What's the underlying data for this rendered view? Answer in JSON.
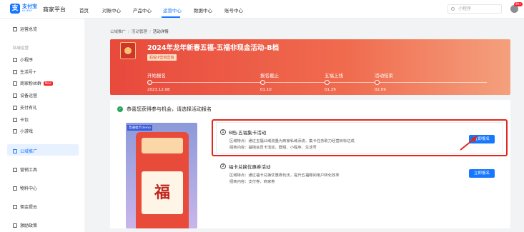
{
  "header": {
    "logo_cn": "支付宝",
    "logo_en": "ALIPAY",
    "platform": "商家平台",
    "nav": [
      "首页",
      "对账中心",
      "产品中心",
      "运营中心",
      "数据中心",
      "账号中心"
    ],
    "active_nav": "运营中心",
    "search_placeholder": "小程序",
    "avatar_badge": "99+"
  },
  "sidebar": {
    "top_item": "运营总览",
    "group_label": "私域运营",
    "items": [
      "小程序",
      "生活号+",
      "商家粉丝群",
      "设备运营",
      "支付有礼",
      "卡包",
      "小游戏"
    ],
    "new_badge": "New",
    "active_item": "公域推广",
    "bottom_items": [
      "营销工具",
      "物料中心",
      "佣金提云",
      "激励政策"
    ]
  },
  "breadcrumb": [
    "公域推广",
    "活动管理",
    "活动详情"
  ],
  "banner": {
    "title": "2024年龙年新春五福-五福非现金活动-B档",
    "tag": "蚂蚁IP营销营销",
    "timeline": [
      {
        "label": "开始报名",
        "date": "2023.12.08"
      },
      {
        "label": "报名截止",
        "date": "01.10"
      },
      {
        "label": "五福上线",
        "date": "01.29"
      },
      {
        "label": "活动结束",
        "date": "02.09"
      }
    ]
  },
  "content": {
    "congrats": "恭喜您获得参与机会，请选择活动报名",
    "promo_label": "普通福卡demo",
    "promo_char": "福",
    "activities": [
      {
        "num": "1",
        "title": "B档-五福集卡活动",
        "feature": "区域特点：通过五福公域流量为商家私域添流、集卡任务助力经营目标达成",
        "scope": "招商内容：基础会员卡活动、群组、小程序、生活号",
        "button": "立即报名"
      },
      {
        "num": "2",
        "title": "福卡兑换优惠券活动",
        "feature": "区域特点：通过福卡兑换优惠券玩法，提升五福曝间用户转化效率",
        "scope": "招商内容：支付券、商家券",
        "button": "立即报名"
      }
    ]
  },
  "colors": {
    "primary": "#1677ff",
    "banner": "#e8493c",
    "highlight": "#e0291c"
  }
}
